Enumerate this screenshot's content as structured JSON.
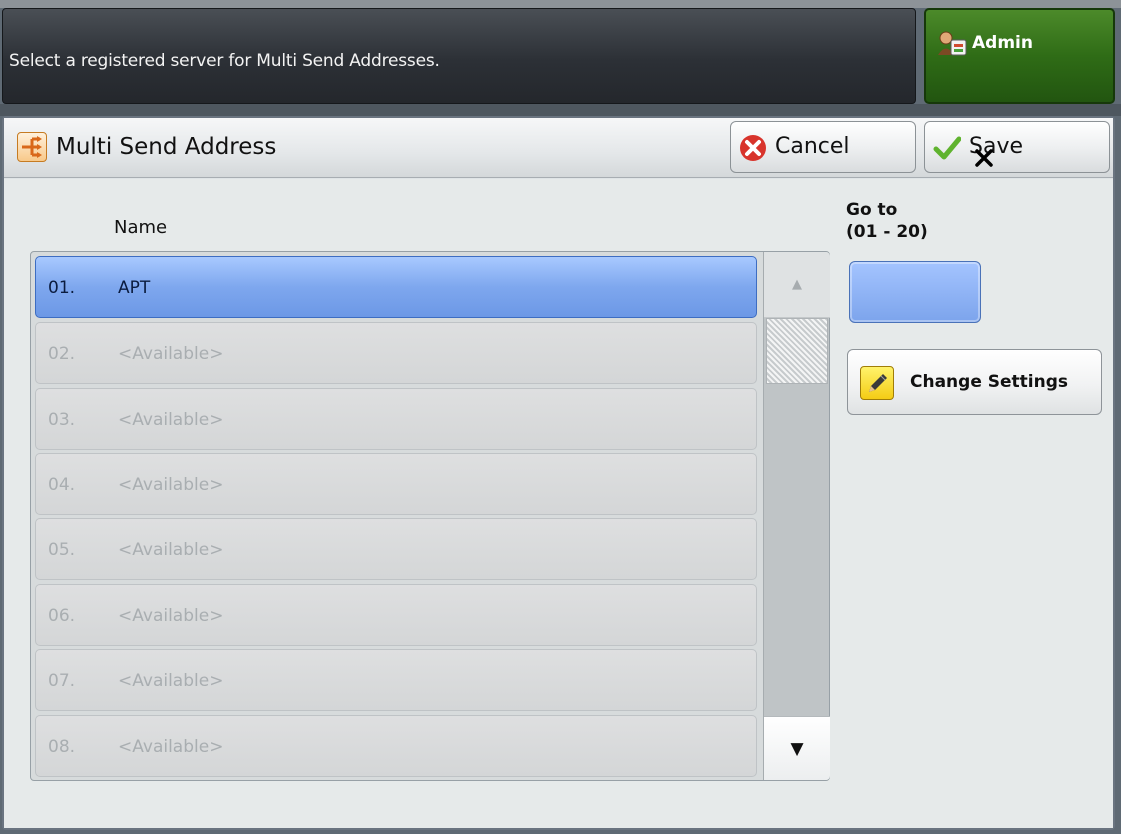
{
  "header": {
    "message": "Select a registered server for Multi Send Addresses.",
    "admin_label": "Admin"
  },
  "window": {
    "title": "Multi Send Address",
    "cancel_label": "Cancel",
    "save_label": "Save"
  },
  "list": {
    "column_header": "Name",
    "rows": [
      {
        "number": "01.",
        "name": "APT",
        "selected": true
      },
      {
        "number": "02.",
        "name": "<Available>",
        "selected": false
      },
      {
        "number": "03.",
        "name": "<Available>",
        "selected": false
      },
      {
        "number": "04.",
        "name": "<Available>",
        "selected": false
      },
      {
        "number": "05.",
        "name": "<Available>",
        "selected": false
      },
      {
        "number": "06.",
        "name": "<Available>",
        "selected": false
      },
      {
        "number": "07.",
        "name": "<Available>",
        "selected": false
      },
      {
        "number": "08.",
        "name": "<Available>",
        "selected": false
      }
    ],
    "scroll_up_glyph": "▲",
    "scroll_down_glyph": "▼"
  },
  "goto": {
    "label_line1": "Go to",
    "label_line2": "(01 - 20)",
    "value": ""
  },
  "change_settings_label": "Change Settings",
  "icons": {
    "admin": "admin-user-icon",
    "title": "multi-send-icon",
    "cancel": "cancel-x-icon",
    "save": "checkmark-icon",
    "change_settings": "pencil-icon",
    "pointer": "pointer-x-icon"
  },
  "colors": {
    "admin_green": "#2f6c16",
    "selected_row": "#7ea7ee",
    "goto_field": "#7ca4ec",
    "cancel_red": "#d8342c",
    "save_green": "#5fb32e",
    "pencil_yellow": "#f4cc15"
  }
}
